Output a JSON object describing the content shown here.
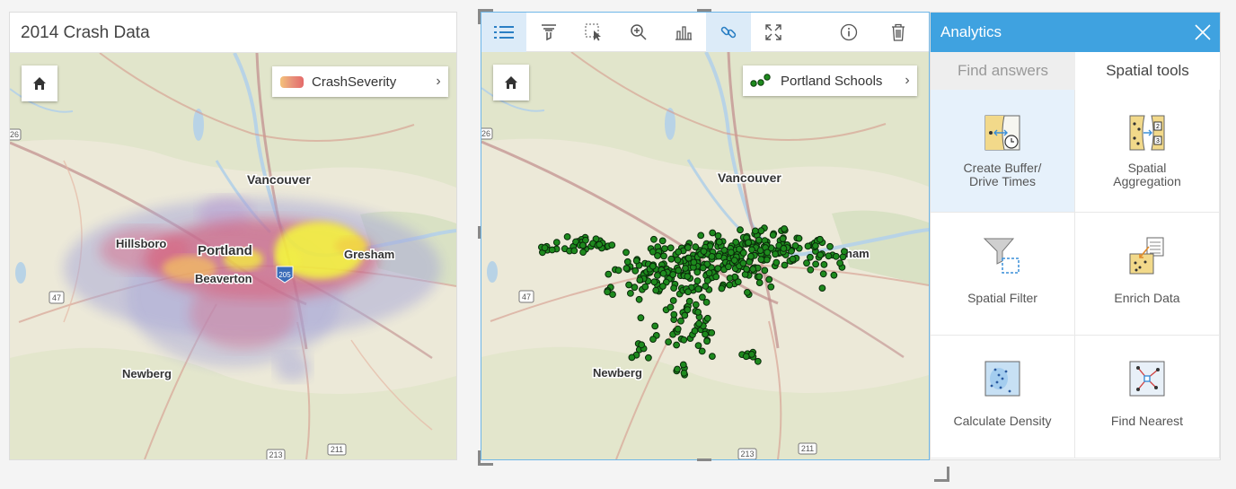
{
  "left_card": {
    "title": "2014 Crash Data",
    "legend_label": "CrashSeverity",
    "map_labels": {
      "vancouver": "Vancouver",
      "hillsboro": "Hillsboro",
      "portland": "Portland",
      "beaverton": "Beaverton",
      "gresham": "Gresham",
      "newberg": "Newberg",
      "hwy26": "26",
      "hwy47": "47",
      "hwy205": "205",
      "hwy213": "213",
      "hwy211": "211"
    }
  },
  "right_card": {
    "toolbar": [
      "legend-icon",
      "filter-icon",
      "select-icon",
      "zoom-icon",
      "chart-icon",
      "link-icon",
      "expand-icon",
      "info-icon",
      "trash-icon"
    ],
    "legend_label": "Portland Schools",
    "map_labels": {
      "vancouver": "Vancouver",
      "gresham": "ham",
      "newberg": "Newberg",
      "hwy26": "26",
      "hwy47": "47",
      "hwy213": "213",
      "hwy211": "211"
    }
  },
  "analytics": {
    "title": "Analytics",
    "tabs": {
      "find_answers": "Find answers",
      "spatial_tools": "Spatial tools"
    },
    "tools": [
      {
        "label": "Create Buffer/\nDrive Times",
        "icon": "buffer-icon",
        "selected": true
      },
      {
        "label": "Spatial\nAggregation",
        "icon": "aggregation-icon",
        "selected": false
      },
      {
        "label": "Spatial Filter",
        "icon": "spatial-filter-icon",
        "selected": false
      },
      {
        "label": "Enrich Data",
        "icon": "enrich-icon",
        "selected": false
      },
      {
        "label": "Calculate Density",
        "icon": "density-icon",
        "selected": false
      },
      {
        "label": "Find Nearest",
        "icon": "nearest-icon",
        "selected": false
      }
    ]
  },
  "colors": {
    "accent": "#3fa2e0",
    "school_dot": "#1e8a1e",
    "heat_hot": "#f2ee3a",
    "heat_mid": "#e0485a"
  }
}
